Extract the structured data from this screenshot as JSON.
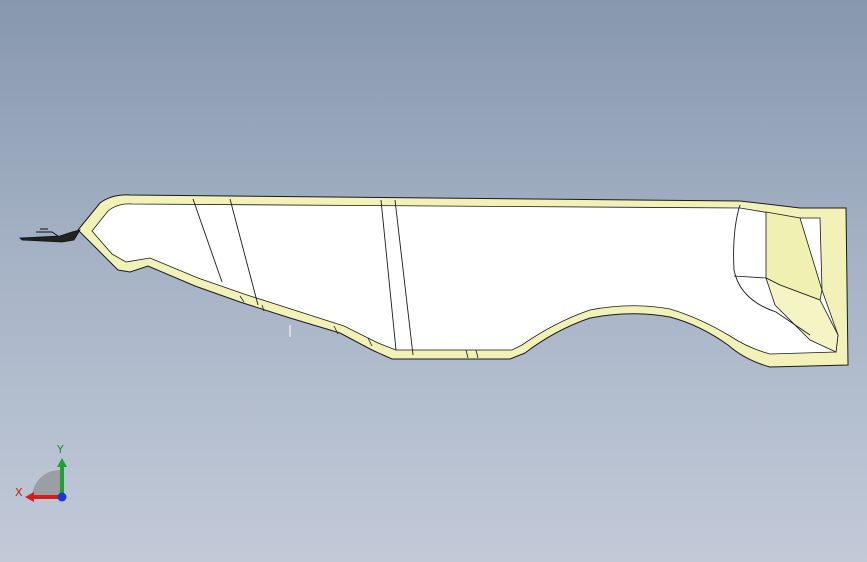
{
  "viewport": {
    "background_top": "#8797ad",
    "background_bottom": "#c2cad8",
    "part_face_color": "#ffffff",
    "part_edge_color": "#f2f2b8",
    "edge_line_color": "#1a1a1a"
  },
  "triad": {
    "x_label": "X",
    "y_label": "Y",
    "x_color": "#d02020",
    "y_color": "#20a030",
    "z_color": "#1a3ad0",
    "icon_name": "coordinate-triad-icon"
  }
}
